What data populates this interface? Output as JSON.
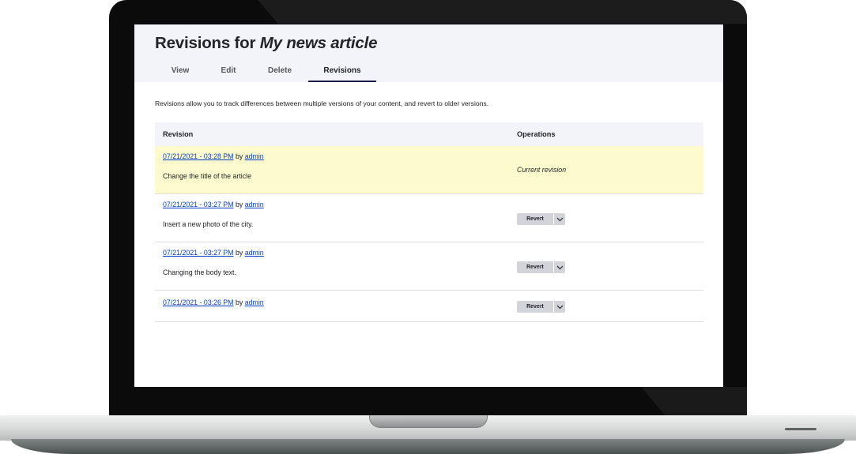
{
  "page": {
    "title_prefix": "Revisions for ",
    "title_node": "My news article",
    "description": "Revisions allow you to track differences between multiple versions of your content, and revert to older versions."
  },
  "tabs": [
    {
      "label": "View"
    },
    {
      "label": "Edit"
    },
    {
      "label": "Delete"
    },
    {
      "label": "Revisions",
      "active": true
    }
  ],
  "table": {
    "headers": {
      "revision": "Revision",
      "operations": "Operations"
    },
    "rows": [
      {
        "date": "07/21/2021 - 03:28 PM",
        "by": "by",
        "author": "admin",
        "message": "Change the title of the article",
        "operation": "Current revision",
        "current": true
      },
      {
        "date": "07/21/2021 - 03:27 PM",
        "by": "by",
        "author": "admin",
        "message": "Insert a new photo of the city.",
        "operation": "Revert"
      },
      {
        "date": "07/21/2021 - 03:27 PM",
        "by": "by",
        "author": "admin",
        "message": "Changing the body text.",
        "operation": "Revert"
      },
      {
        "date": "07/21/2021 - 03:26 PM",
        "by": "by",
        "author": "admin",
        "message": "",
        "operation": "Revert"
      }
    ]
  },
  "icons": {
    "dropdown": "chevron-down-icon"
  },
  "colors": {
    "link": "#003ecc",
    "current_row": "#fdfbcd",
    "header_bg": "#f3f4f9"
  }
}
